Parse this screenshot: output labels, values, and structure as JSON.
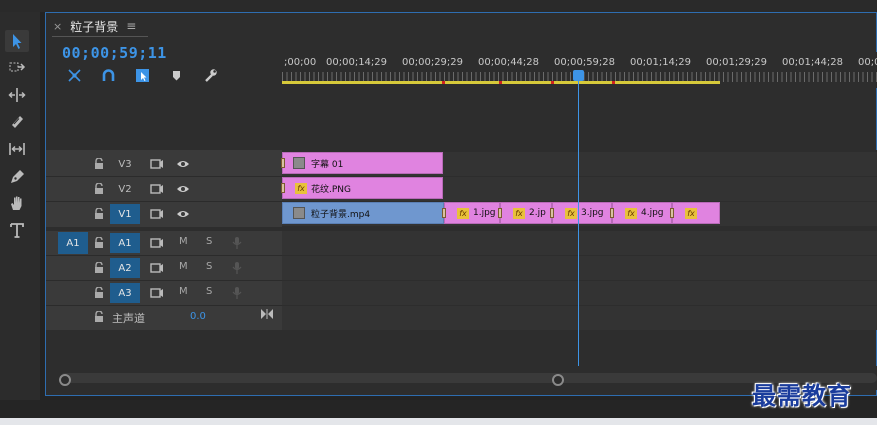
{
  "panel": {
    "close_glyph": "×",
    "title": "粒子背景",
    "menu_glyph": "≡",
    "timecode": "00;00;59;11"
  },
  "tools": [
    "selection-tool",
    "track-select-tool",
    "ripple-edit-tool",
    "razor-tool",
    "slip-tool",
    "pen-tool",
    "hand-tool",
    "type-tool"
  ],
  "ruler": {
    "labels": [
      ";00;00",
      "00;00;14;29",
      "00;00;29;29",
      "00;00;44;28",
      "00;00;59;28",
      "00;01;14;29",
      "00;01;29;29",
      "00;01;44;28",
      "00;0"
    ]
  },
  "video_tracks": [
    {
      "name": "V3"
    },
    {
      "name": "V2"
    },
    {
      "name": "V1"
    }
  ],
  "audio_tracks": [
    {
      "source": "A1",
      "name": "A1",
      "m": "M",
      "s": "S"
    },
    {
      "name": "A2",
      "m": "M",
      "s": "S"
    },
    {
      "name": "A3",
      "m": "M",
      "s": "S"
    }
  ],
  "master": {
    "label": "主声道",
    "value": "0.0"
  },
  "clips": {
    "v3": {
      "name": "字幕 01"
    },
    "v2": {
      "name": "花纹.PNG"
    },
    "v1": {
      "name": "粒子背景.mp4"
    },
    "v1_images": [
      {
        "name": "1.jpg"
      },
      {
        "name": "2.jp"
      },
      {
        "name": "3.jpg"
      },
      {
        "name": "4.jpg"
      },
      {
        "name": ""
      }
    ]
  },
  "fx_label": "fx",
  "watermark": "最需教育",
  "colors": {
    "accent": "#3d94e6",
    "clip_pink": "#e083e0",
    "clip_blue": "#6f97cf",
    "workbar": "#d6c93a"
  }
}
